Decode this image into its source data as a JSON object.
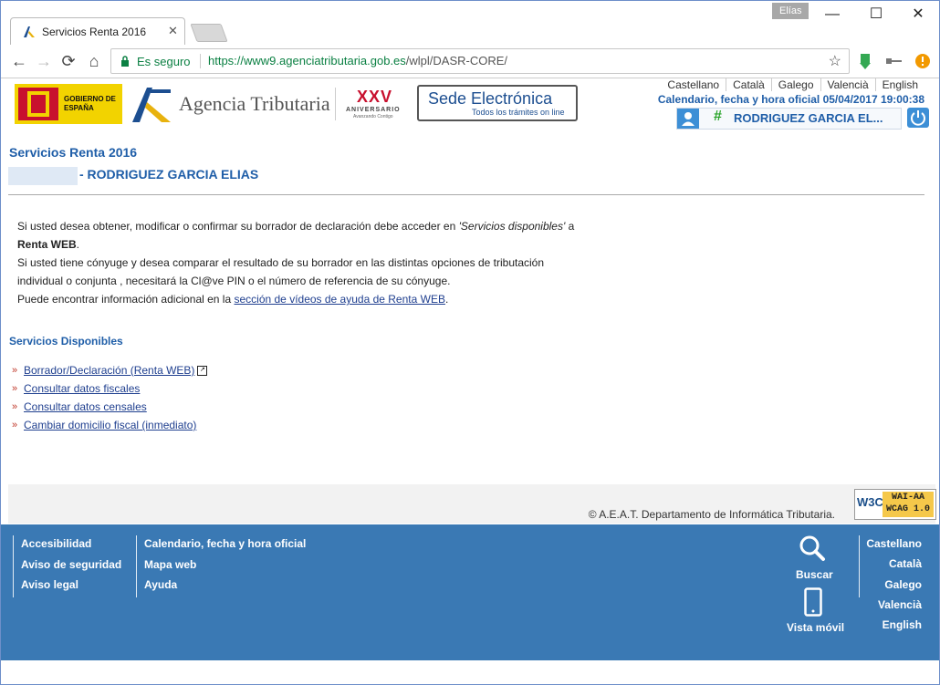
{
  "browser": {
    "tab_title": "Servicios Renta 2016",
    "profile_name": "Elías",
    "secure_label": "Es seguro",
    "url_host": "https://www9.agenciatributaria.gob.es",
    "url_path": "/wlpl/DASR-CORE/"
  },
  "header": {
    "gov_logo_text": "GOBIERNO DE ESPAÑA",
    "agency_name": "Agencia Tributaria",
    "anniversary_mark": "XXV",
    "anniversary_text": "ANIVERSARIO",
    "anniversary_sub": "Avanzando Contigo",
    "sede_title": "Sede Electrónica",
    "sede_subtitle": "Todos los trámites on line",
    "languages": [
      "Castellano",
      "Català",
      "Galego",
      "Valencià",
      "English"
    ],
    "calendar_text": "Calendario, fecha y hora oficial 05/04/2017 19:00:38",
    "user_name": "RODRIGUEZ GARCIA EL..."
  },
  "main": {
    "section_title": "Servicios Renta 2016",
    "taxpayer_name": "- RODRIGUEZ GARCIA ELIAS",
    "intro_p1_a": "Si usted desea obtener, modificar o confirmar su borrador de declaración debe acceder en ",
    "intro_p1_italic": "'Servicios disponibles'",
    "intro_p1_b": " a ",
    "intro_p1_bold": "Renta WEB",
    "intro_p1_c": ".",
    "intro_p2": "Si usted tiene cónyuge y desea comparar el resultado de su borrador en las distintas opciones de tributación individual o conjunta , necesitará la Cl@ve PIN o el número de referencia de su cónyuge.",
    "intro_p3_a": "Puede encontrar información adicional en la ",
    "intro_p3_link": "sección de vídeos de ayuda de Renta WEB",
    "intro_p3_b": ".",
    "services_heading": "Servicios Disponibles",
    "services": [
      "Borrador/Declaración (Renta WEB)",
      "Consultar datos fiscales",
      "Consultar datos censales",
      "Cambiar domicilio fiscal (inmediato)"
    ],
    "copyright": "© A.E.A.T. Departamento de Informática Tributaria.",
    "w3c_logo": "W3C",
    "w3c_badge_line1": "WAI-AA",
    "w3c_badge_line2": "WCAG 1.0"
  },
  "footer": {
    "col1": [
      "Accesibilidad",
      "Aviso de seguridad",
      "Aviso legal"
    ],
    "col2": [
      "Calendario, fecha y hora oficial",
      "Mapa web",
      "Ayuda"
    ],
    "search_label": "Buscar",
    "mobile_label": "Vista móvil",
    "languages": [
      "Castellano",
      "Català",
      "Galego",
      "Valencià",
      "English"
    ]
  }
}
